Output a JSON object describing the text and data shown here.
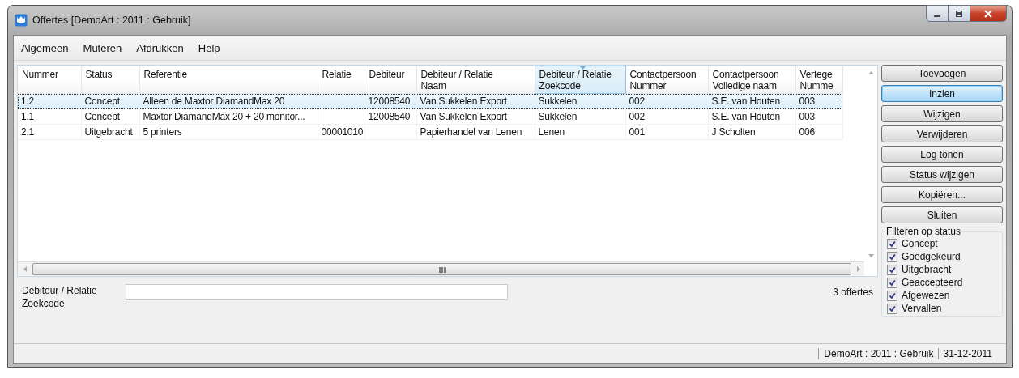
{
  "window": {
    "title": "Offertes [DemoArt : 2011 : Gebruik]"
  },
  "menu": [
    {
      "label": "Algemeen"
    },
    {
      "label": "Muteren"
    },
    {
      "label": "Afdrukken"
    },
    {
      "label": "Help"
    }
  ],
  "table": {
    "columns": [
      {
        "label": "Nummer",
        "sorted": false
      },
      {
        "label": "Status",
        "sorted": false
      },
      {
        "label": "Referentie",
        "sorted": false
      },
      {
        "label": "Relatie",
        "sorted": false
      },
      {
        "label": "Debiteur",
        "sorted": false
      },
      {
        "label": "Debiteur / Relatie\nNaam",
        "sorted": false
      },
      {
        "label": "Debiteur / Relatie\nZoekcode",
        "sorted": true
      },
      {
        "label": "Contactpersoon\nNummer",
        "sorted": false
      },
      {
        "label": "Contactpersoon\nVolledige naam",
        "sorted": false
      },
      {
        "label": "Vertege\nNumme",
        "sorted": false
      }
    ],
    "rows": [
      {
        "selected": true,
        "cells": [
          "1.2",
          "Concept",
          "Alleen de Maxtor DiamandMax 20",
          null,
          "12008540",
          "Van Sukkelen Export",
          "Sukkelen",
          "002",
          "S.E. van Houten",
          "003"
        ]
      },
      {
        "selected": false,
        "cells": [
          "1.1",
          "Concept",
          "Maxtor DiamandMax 20 + 20 monitor...",
          null,
          "12008540",
          "Van Sukkelen Export",
          "Sukkelen",
          "002",
          "S.E. van Houten",
          "003"
        ]
      },
      {
        "selected": false,
        "cells": [
          "2.1",
          "Uitgebracht",
          "5 printers",
          "00001010",
          null,
          "Papierhandel van Lenen",
          "Lenen",
          "001",
          "J Scholten",
          "006"
        ]
      }
    ]
  },
  "buttons": [
    {
      "label": "Toevoegen",
      "default": false
    },
    {
      "label": "Inzien",
      "default": true
    },
    {
      "label": "Wijzigen",
      "default": false
    },
    {
      "label": "Verwijderen",
      "default": false
    },
    {
      "label": "Log tonen",
      "default": false
    },
    {
      "label": "Status wijzigen",
      "default": false
    },
    {
      "label": "Kopiëren...",
      "default": false
    },
    {
      "label": "Sluiten",
      "default": false
    }
  ],
  "filter": {
    "title": "Filteren op status",
    "items": [
      {
        "label": "Concept",
        "checked": true
      },
      {
        "label": "Goedgekeurd",
        "checked": true
      },
      {
        "label": "Uitgebracht",
        "checked": true
      },
      {
        "label": "Geaccepteerd",
        "checked": true
      },
      {
        "label": "Afgewezen",
        "checked": true
      },
      {
        "label": "Vervallen",
        "checked": true
      }
    ]
  },
  "search": {
    "label": "Debiteur / Relatie\nZoekcode"
  },
  "count": "3 offertes",
  "status_bar": [
    "DemoArt : 2011 : Gebruik",
    "31-12-2011"
  ]
}
